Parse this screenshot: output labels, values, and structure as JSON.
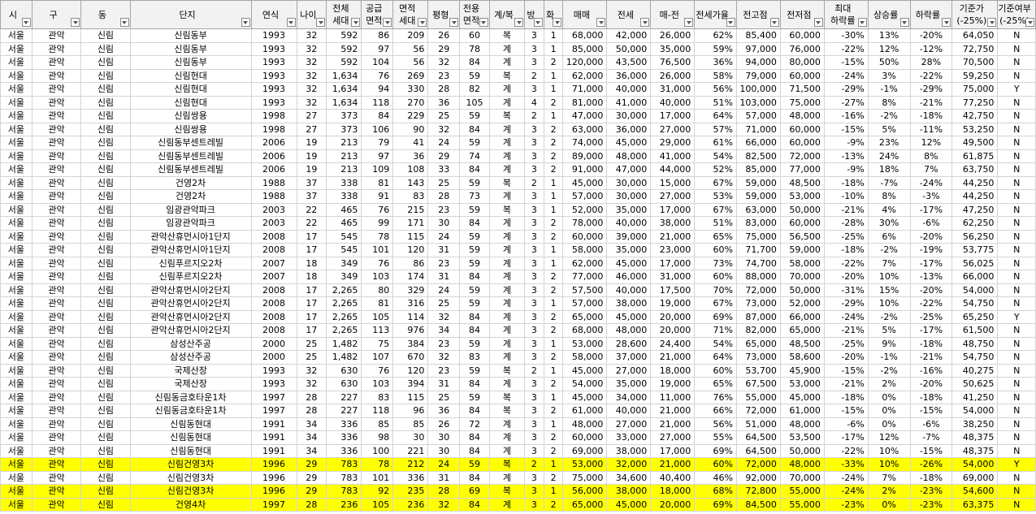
{
  "headers": [
    "시",
    "구",
    "동",
    "단지",
    "연식",
    "나이",
    "전체\n세대",
    "공급\n면적",
    "면적\n세대",
    "평형",
    "전용\n면적",
    "계/복",
    "방",
    "화",
    "매매",
    "전세",
    "매-전",
    "전세가율",
    "전고점",
    "전저점",
    "최대\n하락률",
    "상승률",
    "하락률",
    "기준가\n(-25%)",
    "기준여부\n(-25%)"
  ],
  "rows": [
    {
      "hl": false,
      "cells": [
        "서울",
        "관악",
        "신림",
        "신림동부",
        "1993",
        "32",
        "592",
        "86",
        "209",
        "26",
        "60",
        "복",
        "3",
        "1",
        "68,000",
        "42,000",
        "26,000",
        "62%",
        "85,400",
        "60,000",
        "-30%",
        "13%",
        "-20%",
        "64,050",
        "N"
      ]
    },
    {
      "hl": false,
      "cells": [
        "서울",
        "관악",
        "신림",
        "신림동부",
        "1993",
        "32",
        "592",
        "97",
        "56",
        "29",
        "78",
        "계",
        "3",
        "1",
        "85,000",
        "50,000",
        "35,000",
        "59%",
        "97,000",
        "76,000",
        "-22%",
        "12%",
        "-12%",
        "72,750",
        "N"
      ]
    },
    {
      "hl": false,
      "cells": [
        "서울",
        "관악",
        "신림",
        "신림동부",
        "1993",
        "32",
        "592",
        "104",
        "56",
        "32",
        "84",
        "계",
        "3",
        "2",
        "120,000",
        "43,500",
        "76,500",
        "36%",
        "94,000",
        "80,000",
        "-15%",
        "50%",
        "28%",
        "70,500",
        "N"
      ]
    },
    {
      "hl": false,
      "cells": [
        "서울",
        "관악",
        "신림",
        "신림현대",
        "1993",
        "32",
        "1,634",
        "76",
        "269",
        "23",
        "59",
        "복",
        "2",
        "1",
        "62,000",
        "36,000",
        "26,000",
        "58%",
        "79,000",
        "60,000",
        "-24%",
        "3%",
        "-22%",
        "59,250",
        "N"
      ]
    },
    {
      "hl": false,
      "cells": [
        "서울",
        "관악",
        "신림",
        "신림현대",
        "1993",
        "32",
        "1,634",
        "94",
        "330",
        "28",
        "82",
        "계",
        "3",
        "1",
        "71,000",
        "40,000",
        "31,000",
        "56%",
        "100,000",
        "71,500",
        "-29%",
        "-1%",
        "-29%",
        "75,000",
        "Y"
      ]
    },
    {
      "hl": false,
      "cells": [
        "서울",
        "관악",
        "신림",
        "신림현대",
        "1993",
        "32",
        "1,634",
        "118",
        "270",
        "36",
        "105",
        "계",
        "4",
        "2",
        "81,000",
        "41,000",
        "40,000",
        "51%",
        "103,000",
        "75,000",
        "-27%",
        "8%",
        "-21%",
        "77,250",
        "N"
      ]
    },
    {
      "hl": false,
      "cells": [
        "서울",
        "관악",
        "신림",
        "신림쌍용",
        "1998",
        "27",
        "373",
        "84",
        "229",
        "25",
        "59",
        "복",
        "2",
        "1",
        "47,000",
        "30,000",
        "17,000",
        "64%",
        "57,000",
        "48,000",
        "-16%",
        "-2%",
        "-18%",
        "42,750",
        "N"
      ]
    },
    {
      "hl": false,
      "cells": [
        "서울",
        "관악",
        "신림",
        "신림쌍용",
        "1998",
        "27",
        "373",
        "106",
        "90",
        "32",
        "84",
        "계",
        "3",
        "2",
        "63,000",
        "36,000",
        "27,000",
        "57%",
        "71,000",
        "60,000",
        "-15%",
        "5%",
        "-11%",
        "53,250",
        "N"
      ]
    },
    {
      "hl": false,
      "cells": [
        "서울",
        "관악",
        "신림",
        "신림동부센트레빌",
        "2006",
        "19",
        "213",
        "79",
        "41",
        "24",
        "59",
        "계",
        "3",
        "2",
        "74,000",
        "45,000",
        "29,000",
        "61%",
        "66,000",
        "60,000",
        "-9%",
        "23%",
        "12%",
        "49,500",
        "N"
      ]
    },
    {
      "hl": false,
      "cells": [
        "서울",
        "관악",
        "신림",
        "신림동부센트레빌",
        "2006",
        "19",
        "213",
        "97",
        "36",
        "29",
        "74",
        "계",
        "3",
        "2",
        "89,000",
        "48,000",
        "41,000",
        "54%",
        "82,500",
        "72,000",
        "-13%",
        "24%",
        "8%",
        "61,875",
        "N"
      ]
    },
    {
      "hl": false,
      "cells": [
        "서울",
        "관악",
        "신림",
        "신림동부센트레빌",
        "2006",
        "19",
        "213",
        "109",
        "108",
        "33",
        "84",
        "계",
        "3",
        "2",
        "91,000",
        "47,000",
        "44,000",
        "52%",
        "85,000",
        "77,000",
        "-9%",
        "18%",
        "7%",
        "63,750",
        "N"
      ]
    },
    {
      "hl": false,
      "cells": [
        "서울",
        "관악",
        "신림",
        "건영2차",
        "1988",
        "37",
        "338",
        "81",
        "143",
        "25",
        "59",
        "복",
        "2",
        "1",
        "45,000",
        "30,000",
        "15,000",
        "67%",
        "59,000",
        "48,500",
        "-18%",
        "-7%",
        "-24%",
        "44,250",
        "N"
      ]
    },
    {
      "hl": false,
      "cells": [
        "서울",
        "관악",
        "신림",
        "건영2차",
        "1988",
        "37",
        "338",
        "91",
        "83",
        "28",
        "73",
        "계",
        "3",
        "1",
        "57,000",
        "30,000",
        "27,000",
        "53%",
        "59,000",
        "53,000",
        "-10%",
        "8%",
        "-3%",
        "44,250",
        "N"
      ]
    },
    {
      "hl": false,
      "cells": [
        "서울",
        "관악",
        "신림",
        "임광관악파크",
        "2003",
        "22",
        "465",
        "76",
        "215",
        "23",
        "59",
        "복",
        "3",
        "1",
        "52,000",
        "35,000",
        "17,000",
        "67%",
        "63,000",
        "50,000",
        "-21%",
        "4%",
        "-17%",
        "47,250",
        "N"
      ]
    },
    {
      "hl": false,
      "cells": [
        "서울",
        "관악",
        "신림",
        "임광관악파크",
        "2003",
        "22",
        "465",
        "99",
        "171",
        "30",
        "84",
        "계",
        "3",
        "2",
        "78,000",
        "40,000",
        "38,000",
        "51%",
        "83,000",
        "60,000",
        "-28%",
        "30%",
        "-6%",
        "62,250",
        "N"
      ]
    },
    {
      "hl": false,
      "cells": [
        "서울",
        "관악",
        "신림",
        "관악산휴먼시아1단지",
        "2008",
        "17",
        "545",
        "78",
        "115",
        "24",
        "59",
        "계",
        "3",
        "2",
        "60,000",
        "39,000",
        "21,000",
        "65%",
        "75,000",
        "56,500",
        "-25%",
        "6%",
        "-20%",
        "56,250",
        "N"
      ]
    },
    {
      "hl": false,
      "cells": [
        "서울",
        "관악",
        "신림",
        "관악산휴먼시아1단지",
        "2008",
        "17",
        "545",
        "101",
        "120",
        "31",
        "59",
        "계",
        "3",
        "1",
        "58,000",
        "35,000",
        "23,000",
        "60%",
        "71,700",
        "59,000",
        "-18%",
        "-2%",
        "-19%",
        "53,775",
        "N"
      ]
    },
    {
      "hl": false,
      "cells": [
        "서울",
        "관악",
        "신림",
        "신림푸르지오2차",
        "2007",
        "18",
        "349",
        "76",
        "86",
        "23",
        "59",
        "계",
        "3",
        "1",
        "62,000",
        "45,000",
        "17,000",
        "73%",
        "74,700",
        "58,000",
        "-22%",
        "7%",
        "-17%",
        "56,025",
        "N"
      ]
    },
    {
      "hl": false,
      "cells": [
        "서울",
        "관악",
        "신림",
        "신림푸르지오2차",
        "2007",
        "18",
        "349",
        "103",
        "174",
        "31",
        "84",
        "계",
        "3",
        "2",
        "77,000",
        "46,000",
        "31,000",
        "60%",
        "88,000",
        "70,000",
        "-20%",
        "10%",
        "-13%",
        "66,000",
        "N"
      ]
    },
    {
      "hl": false,
      "cells": [
        "서울",
        "관악",
        "신림",
        "관악산휴먼시아2단지",
        "2008",
        "17",
        "2,265",
        "80",
        "329",
        "24",
        "59",
        "계",
        "3",
        "2",
        "57,500",
        "40,000",
        "17,500",
        "70%",
        "72,000",
        "50,000",
        "-31%",
        "15%",
        "-20%",
        "54,000",
        "N"
      ]
    },
    {
      "hl": false,
      "cells": [
        "서울",
        "관악",
        "신림",
        "관악산휴먼시아2단지",
        "2008",
        "17",
        "2,265",
        "81",
        "316",
        "25",
        "59",
        "계",
        "3",
        "1",
        "57,000",
        "38,000",
        "19,000",
        "67%",
        "73,000",
        "52,000",
        "-29%",
        "10%",
        "-22%",
        "54,750",
        "N"
      ]
    },
    {
      "hl": false,
      "cells": [
        "서울",
        "관악",
        "신림",
        "관악산휴먼시아2단지",
        "2008",
        "17",
        "2,265",
        "105",
        "114",
        "32",
        "84",
        "계",
        "3",
        "2",
        "65,000",
        "45,000",
        "20,000",
        "69%",
        "87,000",
        "66,000",
        "-24%",
        "-2%",
        "-25%",
        "65,250",
        "Y"
      ]
    },
    {
      "hl": false,
      "cells": [
        "서울",
        "관악",
        "신림",
        "관악산휴먼시아2단지",
        "2008",
        "17",
        "2,265",
        "113",
        "976",
        "34",
        "84",
        "계",
        "3",
        "2",
        "68,000",
        "48,000",
        "20,000",
        "71%",
        "82,000",
        "65,000",
        "-21%",
        "5%",
        "-17%",
        "61,500",
        "N"
      ]
    },
    {
      "hl": false,
      "cells": [
        "서울",
        "관악",
        "신림",
        "삼성산주공",
        "2000",
        "25",
        "1,482",
        "75",
        "384",
        "23",
        "59",
        "계",
        "3",
        "1",
        "53,000",
        "28,600",
        "24,400",
        "54%",
        "65,000",
        "48,500",
        "-25%",
        "9%",
        "-18%",
        "48,750",
        "N"
      ]
    },
    {
      "hl": false,
      "cells": [
        "서울",
        "관악",
        "신림",
        "삼성산주공",
        "2000",
        "25",
        "1,482",
        "107",
        "670",
        "32",
        "83",
        "계",
        "3",
        "2",
        "58,000",
        "37,000",
        "21,000",
        "64%",
        "73,000",
        "58,600",
        "-20%",
        "-1%",
        "-21%",
        "54,750",
        "N"
      ]
    },
    {
      "hl": false,
      "cells": [
        "서울",
        "관악",
        "신림",
        "국제산장",
        "1993",
        "32",
        "630",
        "76",
        "120",
        "23",
        "59",
        "복",
        "2",
        "1",
        "45,000",
        "27,000",
        "18,000",
        "60%",
        "53,700",
        "45,900",
        "-15%",
        "-2%",
        "-16%",
        "40,275",
        "N"
      ]
    },
    {
      "hl": false,
      "cells": [
        "서울",
        "관악",
        "신림",
        "국제산장",
        "1993",
        "32",
        "630",
        "103",
        "394",
        "31",
        "84",
        "계",
        "3",
        "2",
        "54,000",
        "35,000",
        "19,000",
        "65%",
        "67,500",
        "53,000",
        "-21%",
        "2%",
        "-20%",
        "50,625",
        "N"
      ]
    },
    {
      "hl": false,
      "cells": [
        "서울",
        "관악",
        "신림",
        "신림동금호타운1차",
        "1997",
        "28",
        "227",
        "83",
        "115",
        "25",
        "59",
        "복",
        "3",
        "1",
        "45,000",
        "34,000",
        "11,000",
        "76%",
        "55,000",
        "45,000",
        "-18%",
        "0%",
        "-18%",
        "41,250",
        "N"
      ]
    },
    {
      "hl": false,
      "cells": [
        "서울",
        "관악",
        "신림",
        "신림동금호타운1차",
        "1997",
        "28",
        "227",
        "118",
        "96",
        "36",
        "84",
        "복",
        "3",
        "2",
        "61,000",
        "40,000",
        "21,000",
        "66%",
        "72,000",
        "61,000",
        "-15%",
        "0%",
        "-15%",
        "54,000",
        "N"
      ]
    },
    {
      "hl": false,
      "cells": [
        "서울",
        "관악",
        "신림",
        "신림동현대",
        "1991",
        "34",
        "336",
        "85",
        "85",
        "26",
        "72",
        "계",
        "3",
        "1",
        "48,000",
        "27,000",
        "21,000",
        "56%",
        "51,000",
        "48,000",
        "-6%",
        "0%",
        "-6%",
        "38,250",
        "N"
      ]
    },
    {
      "hl": false,
      "cells": [
        "서울",
        "관악",
        "신림",
        "신림동현대",
        "1991",
        "34",
        "336",
        "98",
        "30",
        "30",
        "84",
        "계",
        "3",
        "2",
        "60,000",
        "33,000",
        "27,000",
        "55%",
        "64,500",
        "53,500",
        "-17%",
        "12%",
        "-7%",
        "48,375",
        "N"
      ]
    },
    {
      "hl": false,
      "cells": [
        "서울",
        "관악",
        "신림",
        "신림동현대",
        "1991",
        "34",
        "336",
        "100",
        "221",
        "30",
        "84",
        "계",
        "3",
        "2",
        "69,000",
        "38,000",
        "17,000",
        "69%",
        "64,500",
        "50,000",
        "-22%",
        "10%",
        "-15%",
        "48,375",
        "N"
      ]
    },
    {
      "hl": true,
      "cells": [
        "서울",
        "관악",
        "신림",
        "신림건영3차",
        "1996",
        "29",
        "783",
        "78",
        "212",
        "24",
        "59",
        "복",
        "2",
        "1",
        "53,000",
        "32,000",
        "21,000",
        "60%",
        "72,000",
        "48,000",
        "-33%",
        "10%",
        "-26%",
        "54,000",
        "Y"
      ]
    },
    {
      "hl": false,
      "cells": [
        "서울",
        "관악",
        "신림",
        "신림건영3차",
        "1996",
        "29",
        "783",
        "101",
        "336",
        "31",
        "84",
        "계",
        "3",
        "2",
        "75,000",
        "34,600",
        "40,400",
        "46%",
        "92,000",
        "70,000",
        "-24%",
        "7%",
        "-18%",
        "69,000",
        "N"
      ]
    },
    {
      "hl": true,
      "cells": [
        "서울",
        "관악",
        "신림",
        "신림건영3차",
        "1996",
        "29",
        "783",
        "92",
        "235",
        "28",
        "69",
        "복",
        "3",
        "1",
        "56,000",
        "38,000",
        "18,000",
        "68%",
        "72,800",
        "55,000",
        "-24%",
        "2%",
        "-23%",
        "54,600",
        "N"
      ]
    },
    {
      "hl": true,
      "cells": [
        "서울",
        "관악",
        "신림",
        "건영4차",
        "1997",
        "28",
        "236",
        "105",
        "236",
        "32",
        "84",
        "계",
        "3",
        "2",
        "65,000",
        "45,000",
        "20,000",
        "69%",
        "84,500",
        "55,000",
        "-23%",
        "0%",
        "-23%",
        "63,375",
        "N"
      ]
    }
  ]
}
